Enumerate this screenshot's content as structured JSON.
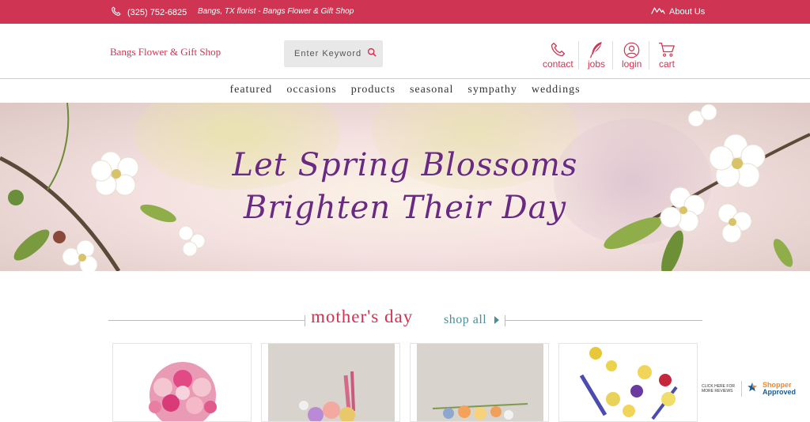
{
  "topbar": {
    "phone": "(325) 752-6825",
    "tagline": "Bangs, TX florist - Bangs Flower & Gift Shop",
    "about": "About Us"
  },
  "header": {
    "logo": "Bangs Flower & Gift Shop",
    "search_placeholder": "Enter Keyword",
    "utils": {
      "contact": "contact",
      "jobs": "jobs",
      "login": "login",
      "cart": "cart"
    }
  },
  "nav": [
    "featured",
    "occasions",
    "products",
    "seasonal",
    "sympathy",
    "weddings"
  ],
  "hero": {
    "line1": "Let Spring Blossoms",
    "line2": "Brighten Their Day"
  },
  "section": {
    "title": "mother's day",
    "shop_all": "shop all"
  },
  "badge": {
    "small": "CLICK HERE FOR MORE REVIEWS",
    "brand1": "Shopper",
    "brand2": "Approved"
  },
  "colors": {
    "brand": "#cf3552",
    "hero_text": "#6a2a82",
    "link_teal": "#4b8e99"
  }
}
